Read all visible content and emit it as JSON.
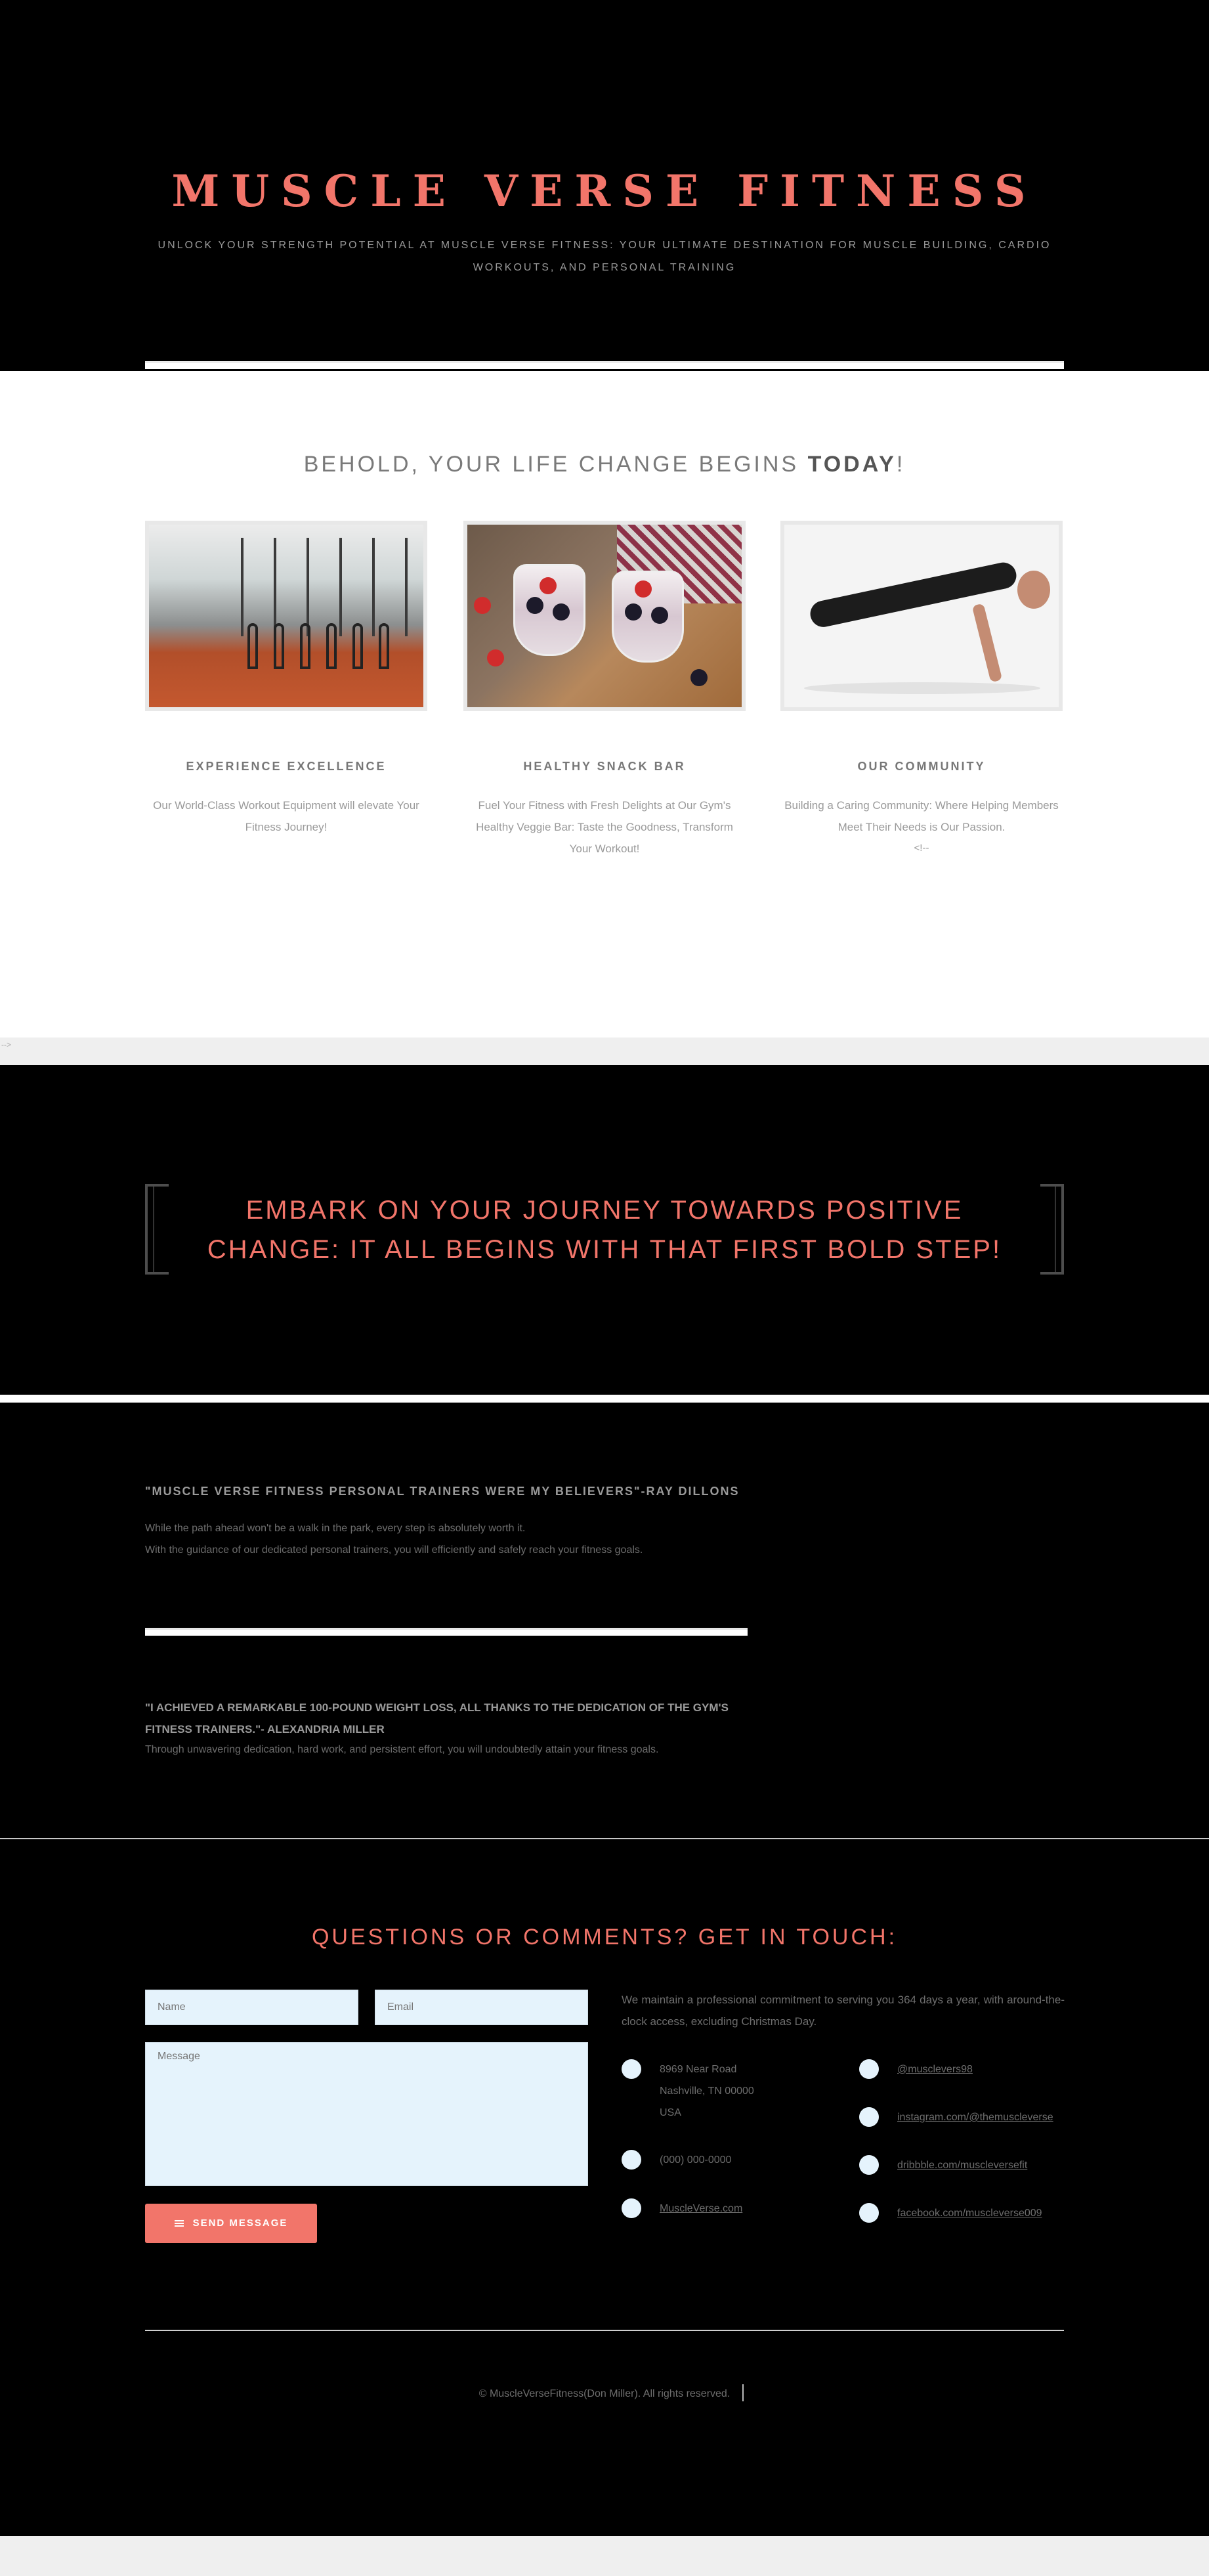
{
  "header": {
    "title": "MUSCLE VERSE FITNESS",
    "tagline": "UNLOCK YOUR STRENGTH POTENTIAL AT MUSCLE VERSE FITNESS: YOUR ULTIMATE DESTINATION FOR MUSCLE BUILDING, CARDIO WORKOUTS, AND PERSONAL TRAINING"
  },
  "features": {
    "heading_prefix": "BEHOLD, YOUR LIFE CHANGE BEGINS ",
    "heading_bold": "TODAY",
    "heading_suffix": "!",
    "cards": [
      {
        "title": "EXPERIENCE EXCELLENCE",
        "text": "Our World-Class Workout Equipment will elevate Your Fitness Journey!"
      },
      {
        "title": "HEALTHY SNACK BAR",
        "text": "Fuel Your Fitness with Fresh Delights at Our Gym's Healthy Veggie Bar: Taste the Goodness, Transform Your Workout!"
      },
      {
        "title": "OUR COMMUNITY",
        "text": "Building a Caring Community: Where Helping Members Meet Their Needs is Our Passion.",
        "extra": "<!--"
      }
    ],
    "stray_comment": "-->"
  },
  "banner": {
    "text": "EMBARK ON YOUR JOURNEY TOWARDS POSITIVE CHANGE: IT ALL BEGINS WITH THAT FIRST BOLD STEP!"
  },
  "testimonials": {
    "first": {
      "title": "\"MUSCLE VERSE FITNESS PERSONAL TRAINERS WERE MY BELIEVERS\"-RAY DILLONS",
      "line1": "While the path ahead won't be a walk in the park, every step is absolutely worth it.",
      "line2": "With the guidance of our dedicated personal trainers, you will efficiently and safely reach your fitness goals."
    },
    "second": {
      "title": "\"I ACHIEVED A REMARKABLE 100-POUND WEIGHT LOSS, ALL THANKS TO THE DEDICATION OF THE GYM'S FITNESS TRAINERS.\"- ALEXANDRIA MILLER",
      "line1": "Through unwavering dedication, hard work, and persistent effort, you will undoubtedly attain your fitness goals."
    }
  },
  "contact": {
    "heading": "QUESTIONS OR COMMENTS? GET IN TOUCH:",
    "name_placeholder": "Name",
    "email_placeholder": "Email",
    "message_placeholder": "Message",
    "send_label": "SEND MESSAGE",
    "intro": "We maintain a professional commitment to serving you 364 days a year, with around-the-clock access, excluding Christmas Day.",
    "address_line1": "8969 Near Road",
    "address_line2": "Nashville, TN 00000",
    "address_line3": "USA",
    "phone": "(000) 000-0000",
    "website": "MuscleVerse.com",
    "socials": [
      "@musclevers98",
      "instagram.com/@themuscleverse",
      "dribbble.com/muscleversefit",
      "facebook.com/muscleverse009"
    ]
  },
  "footer": {
    "copyright": "© MuscleVerseFitness(Don Miller). All rights reserved."
  }
}
